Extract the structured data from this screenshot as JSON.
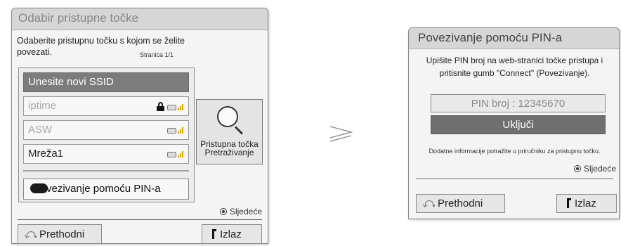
{
  "left_dialog": {
    "title": "Odabir pristupne točke",
    "description": "Odaberite pristupnu točku s kojom se želite povezati.",
    "page_indicator": "Stranica 1/1",
    "new_ssid_label": "Unesite novi SSID",
    "access_points": [
      {
        "name": "iptime",
        "locked": true
      },
      {
        "name": "ASW",
        "locked": false
      },
      {
        "name": "Mreža1",
        "locked": false
      }
    ],
    "pin_connect_label": "vezivanje pomoću PIN-a",
    "search_button_label_1": "Pristupna točka",
    "search_button_label_2": "Pretraživanje",
    "next_label": "Sljedeće",
    "back_label": "Prethodni",
    "exit_label": "Izlaz"
  },
  "arrow": "≥",
  "right_dialog": {
    "title": "Povezivanje pomoću PIN-a",
    "instruction_line1": "Upišite PIN broj na web-stranici točke pristupa i",
    "instruction_line2": "pritisnite gumb \"Connect\" (Povezivanje).",
    "pin_display": "PIN broj : 12345670",
    "connect_label": "Uključi",
    "note": "Dodatne informacije potražite u priručniku za pristupnu točku.",
    "next_label": "Sljedeće",
    "back_label": "Prethodni",
    "exit_label": "Izlaz"
  },
  "colors": {
    "selected_item_bg": "#7c7c7c",
    "connect_button_bg": "#6f6f6f",
    "title_bar_bg": "#d6d6d6",
    "signal_bars": "#d9a400"
  }
}
